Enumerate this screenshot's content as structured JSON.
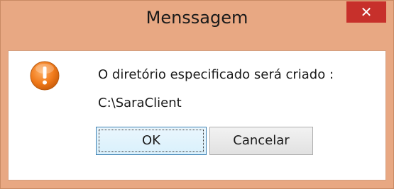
{
  "window": {
    "title": "Menssagem",
    "close_symbol": "✕",
    "frame_color": "#e8a883",
    "close_color": "#c7302b"
  },
  "dialog": {
    "icon": "warning-icon",
    "message_line1": "O diretório especificado será criado :",
    "message_line2": "C:\\SaraClient"
  },
  "buttons": {
    "ok_label": "OK",
    "cancel_label": "Cancelar"
  }
}
